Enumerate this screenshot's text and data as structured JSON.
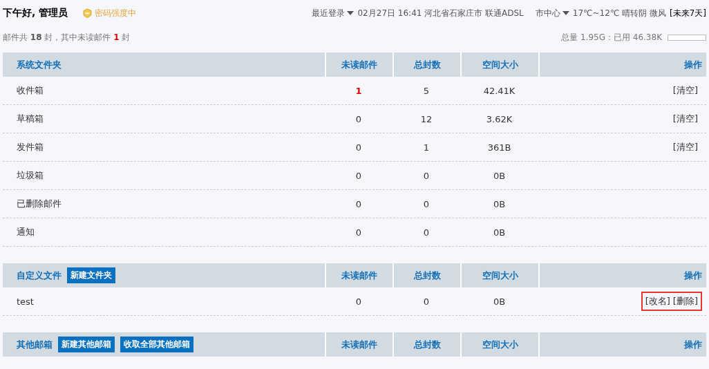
{
  "header": {
    "greeting": "下午好, 管理员",
    "password_strength": "密码强度中",
    "last_login_label": "最近登录",
    "last_login": "02月27日 16:41 河北省石家庄市 联通ADSL",
    "city": "市中心",
    "weather": "17℃~12℃ 晴转阴 微风",
    "forecast_link": "[未来7天]"
  },
  "summary": {
    "before": "邮件共",
    "total": "18",
    "middle": "封，其中未读邮件",
    "unread": "1",
    "after": "封"
  },
  "quota": {
    "text": "总量 1.95G：已用 46.38K",
    "level": 0
  },
  "sections": [
    {
      "title": "系统文件夹",
      "columns": [
        "未读邮件",
        "总封数",
        "空间大小",
        "操作"
      ],
      "rows": [
        {
          "name": "收件箱",
          "unread": "1",
          "has_unread": true,
          "total": "5",
          "size": "42.41K",
          "actions": [
            "[清空]"
          ]
        },
        {
          "name": "草稿箱",
          "unread": "0",
          "has_unread": false,
          "total": "12",
          "size": "3.62K",
          "actions": [
            "[清空]"
          ]
        },
        {
          "name": "发件箱",
          "unread": "0",
          "has_unread": false,
          "total": "1",
          "size": "361B",
          "actions": [
            "[清空]"
          ]
        },
        {
          "name": "垃圾箱",
          "unread": "0",
          "has_unread": false,
          "total": "0",
          "size": "0B"
        },
        {
          "name": "已删除邮件",
          "unread": "0",
          "has_unread": false,
          "total": "0",
          "size": "0B"
        },
        {
          "name": "通知",
          "unread": "0",
          "has_unread": false,
          "total": "0",
          "size": "0B"
        }
      ]
    },
    {
      "title": "自定义文件",
      "buttons": [
        "新建文件夹"
      ],
      "columns": [
        "未读邮件",
        "总封数",
        "空间大小",
        "操作"
      ],
      "rows": [
        {
          "name": "test",
          "unread": "0",
          "has_unread": false,
          "total": "0",
          "size": "0B",
          "actions": [
            "[改名]",
            "[删除]"
          ],
          "highlighted": true
        }
      ]
    },
    {
      "title": "其他邮箱",
      "buttons": [
        "新建其他邮箱",
        "收取全部其他邮箱"
      ],
      "columns": [
        "未读邮件",
        "总封数",
        "空间大小",
        "操作"
      ]
    }
  ]
}
